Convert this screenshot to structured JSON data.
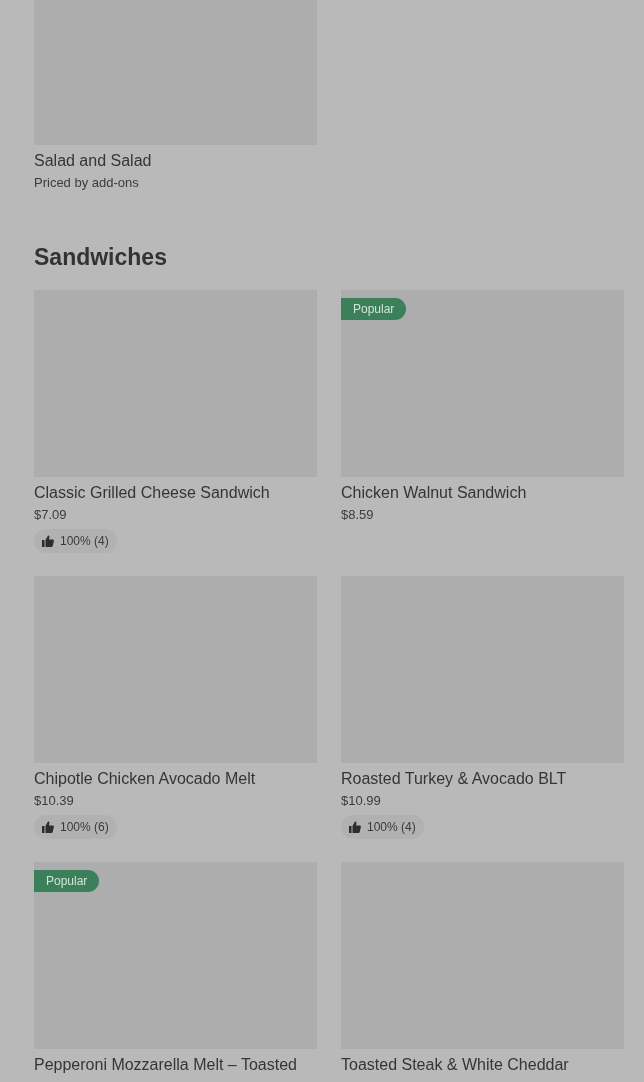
{
  "previous_item": {
    "name": "Salad and Salad",
    "price": "Priced by add-ons"
  },
  "section": {
    "heading": "Sandwiches",
    "rows": [
      {
        "items": [
          {
            "name": "Classic Grilled Cheese Sandwich",
            "price": "$7.09",
            "popular": false,
            "rating": "100% (4)"
          },
          {
            "name": "Chicken Walnut Sandwich",
            "price": "$8.59",
            "popular": true,
            "badge": "Popular"
          }
        ]
      },
      {
        "items": [
          {
            "name": "Chipotle Chicken Avocado Melt",
            "price": "$10.39",
            "popular": false,
            "rating": "100% (6)"
          },
          {
            "name": "Roasted Turkey & Avocado BLT",
            "price": "$10.99",
            "popular": false,
            "rating": "100% (4)"
          }
        ]
      },
      {
        "items": [
          {
            "name": "Pepperoni Mozzarella Melt – Toasted",
            "popular": true,
            "badge": "Popular"
          },
          {
            "name": "Toasted Steak & White Cheddar",
            "popular": false
          }
        ]
      }
    ]
  }
}
